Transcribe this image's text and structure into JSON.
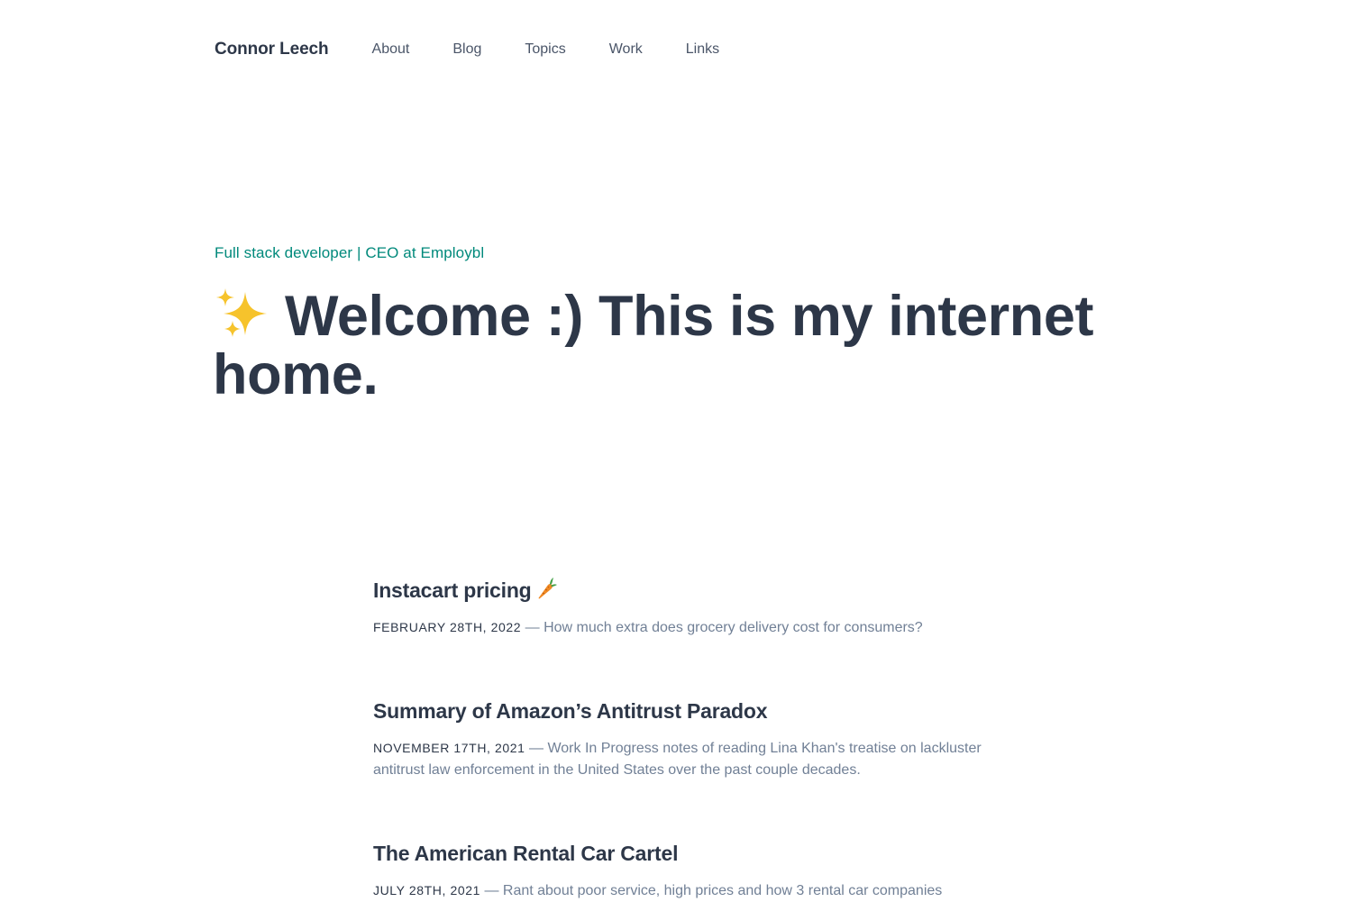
{
  "nav": {
    "brand": "Connor Leech",
    "links": [
      "About",
      "Blog",
      "Topics",
      "Work",
      "Links"
    ]
  },
  "hero": {
    "tagline": "Full stack developer | CEO at Employbl",
    "icon": "sparkles-icon",
    "title": "Welcome :) This is my internet home."
  },
  "posts": [
    {
      "title": "Instacart pricing",
      "title_icon": "carrot-icon",
      "date": "February 28th, 2022",
      "separator": " — ",
      "summary": "How much extra does grocery delivery cost for consumers?"
    },
    {
      "title": "Summary of Amazon’s Antitrust Paradox",
      "date": "November 17th, 2021",
      "separator": " — ",
      "summary": "Work In Progress notes of reading Lina Khan's treatise on lackluster antitrust law enforcement in the United States over the past couple decades."
    },
    {
      "title": "The American Rental Car Cartel",
      "date": "July 28th, 2021",
      "separator": " — ",
      "summary": "Rant about poor service, high prices and how 3 rental car companies"
    }
  ],
  "colors": {
    "text": "#2d3748",
    "muted": "#718096",
    "accent": "#00897b",
    "sparkle": "#f6c32c",
    "carrot": "#f08a24",
    "carrot_leaf": "#43a047"
  }
}
